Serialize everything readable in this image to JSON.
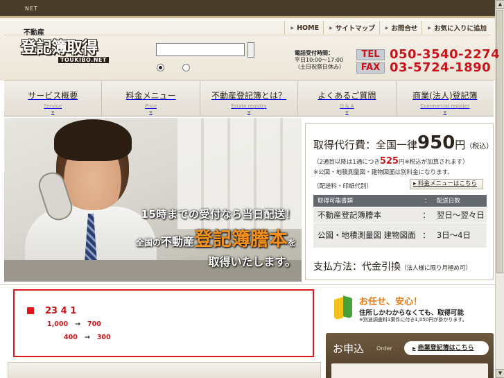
{
  "topbar": {
    "label": "NET"
  },
  "util_nav": [
    {
      "label": "HOME"
    },
    {
      "label": "サイトマップ"
    },
    {
      "label": "お問合せ"
    },
    {
      "label": "お気に入りに追加"
    }
  ],
  "logo": {
    "small": "不動産",
    "main": "登記簿取得",
    "sub": "TOUKIBO.NET"
  },
  "search": {
    "value": "",
    "radio_selected": 1
  },
  "hours": {
    "title": "電話受付時間：",
    "line1": "平日10:00〜17:00",
    "line2": "（土日祝祭日休み）"
  },
  "contact": {
    "tel_label": "TEL",
    "tel": "050-3540-2274",
    "fax_label": "FAX",
    "fax": "03-5724-1890"
  },
  "main_nav": [
    {
      "label": "サービス概要",
      "sub": "Service"
    },
    {
      "label": "料金メニュー",
      "sub": "Price"
    },
    {
      "label": "不動産登記簿とは？",
      "sub": "Estate registry"
    },
    {
      "label": "よくあるご質問",
      "sub": "Q & A"
    },
    {
      "label": "商業(法人)登記簿",
      "sub": "Commercial register"
    }
  ],
  "hero": {
    "line1": "15時までの受付なら当日配送！",
    "line2_pre": "全国の",
    "line2_mid": "不動産",
    "line2_big": "登記簿謄本",
    "line2_post": "を",
    "line3": "取得いたします。"
  },
  "price": {
    "head_pre": "取得代行費：全国一律",
    "head_price": "950",
    "head_unit": "円",
    "head_tax": "（税込）",
    "note1_pre": "（2通目以降は1通につき",
    "note1_price": "525",
    "note1_post": "円※税込が加算されます）",
    "note2": "※公図・地積測量図・建物図面は別料金になります。",
    "note3": "（配送料・印紙代別）",
    "fee_menu_button": "料金メニューはこちら",
    "table": {
      "header_item": "取得可能書類",
      "header_sep": "：",
      "header_days": "配送日数",
      "rows": [
        {
          "doc": "不動産登記簿謄本",
          "sep": "：",
          "days": "翌日〜翌々日"
        },
        {
          "doc": "公図・地積測量図 建物図面",
          "sep": "：",
          "days": "3日〜4日"
        }
      ]
    },
    "payment_main": "支払方法：代金引換",
    "payment_note": "（法人様に限り月極め可）"
  },
  "notice": {
    "row1": "23 4 1",
    "row2_from": "1,000",
    "row2_to": "700",
    "row3_from": "400",
    "row3_to": "300",
    "arrow": "→"
  },
  "anshin": {
    "title": "お任せ、安心！",
    "text": "住所しかわからなくても、取得可能",
    "small": "※別途調査料1案件に付き1,050円が掛かります。"
  },
  "order": {
    "title": "お申込",
    "title_en": "Order",
    "commercial_button": "商業登記簿はこちら"
  },
  "colors": {
    "brand_brown": "#4b3d2c",
    "accent_red": "#c7151b",
    "accent_orange": "#e87a10"
  }
}
